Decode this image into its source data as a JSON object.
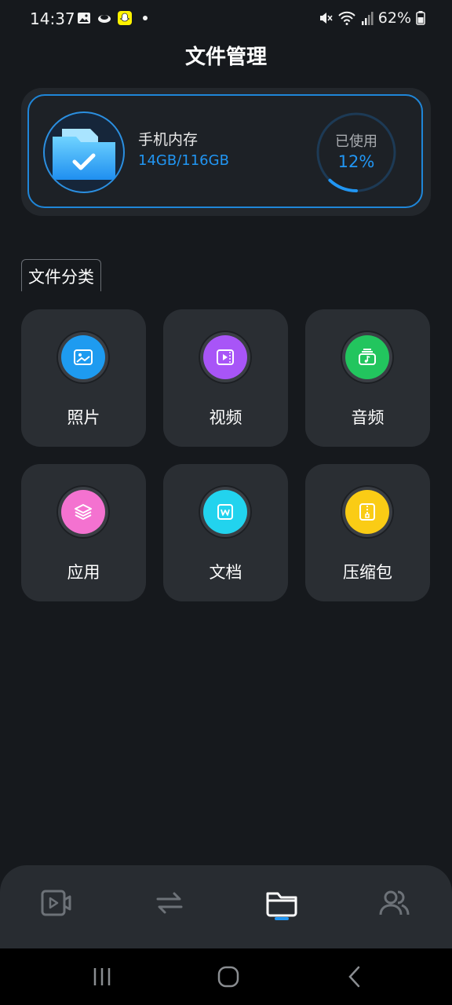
{
  "status_bar": {
    "time": "14:37",
    "battery": "62%",
    "icons": [
      "gallery-icon",
      "cloud-icon",
      "snapchat-icon",
      "dot-icon",
      "mute-icon",
      "wifi-icon",
      "signal-icon",
      "battery-icon"
    ]
  },
  "header": {
    "title": "文件管理"
  },
  "storage": {
    "label": "手机内存",
    "value": "14GB/116GB",
    "used_label": "已使用",
    "used_percent": "12%",
    "used_fraction": 0.12
  },
  "section": {
    "title": "文件分类"
  },
  "categories": [
    {
      "label": "照片",
      "icon": "photo-icon",
      "color": "#1e9bf0"
    },
    {
      "label": "视频",
      "icon": "video-icon",
      "color": "#a855f7"
    },
    {
      "label": "音频",
      "icon": "audio-icon",
      "color": "#22c55e"
    },
    {
      "label": "应用",
      "icon": "app-icon",
      "color": "#f472d0"
    },
    {
      "label": "文档",
      "icon": "document-icon",
      "color": "#22d3ee"
    },
    {
      "label": "压缩包",
      "icon": "zip-icon",
      "color": "#facc15"
    }
  ],
  "bottom_nav": {
    "items": [
      "video-player-icon",
      "transfer-icon",
      "folder-icon",
      "users-icon"
    ],
    "active": 2
  },
  "colors": {
    "accent": "#2196f3",
    "background": "#16191d",
    "card": "#2a2e33"
  }
}
